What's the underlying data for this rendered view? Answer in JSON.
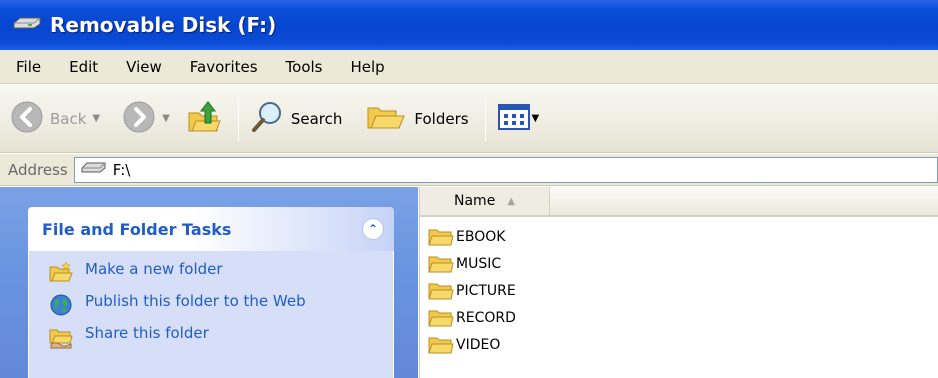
{
  "window": {
    "title": "Removable Disk (F:)"
  },
  "menu": {
    "items": [
      "File",
      "Edit",
      "View",
      "Favorites",
      "Tools",
      "Help"
    ]
  },
  "toolbar": {
    "back_label": "Back",
    "search_label": "Search",
    "folders_label": "Folders"
  },
  "address": {
    "label": "Address",
    "value": "F:\\"
  },
  "tasks": {
    "title": "File and Folder Tasks",
    "items": [
      {
        "label": "Make a new folder",
        "icon": "new-folder-icon"
      },
      {
        "label": "Publish this folder to the Web",
        "icon": "globe-icon"
      },
      {
        "label": "Share this folder",
        "icon": "share-folder-icon"
      }
    ]
  },
  "filelist": {
    "columns": [
      "Name"
    ],
    "files": [
      "EBOOK",
      "MUSIC",
      "PICTURE",
      "RECORD",
      "VIDEO"
    ]
  },
  "colors": {
    "titlebar": "#0645d0",
    "taskpane": "#6b95e0",
    "link": "#215dc6",
    "menubar": "#ece9d8"
  }
}
